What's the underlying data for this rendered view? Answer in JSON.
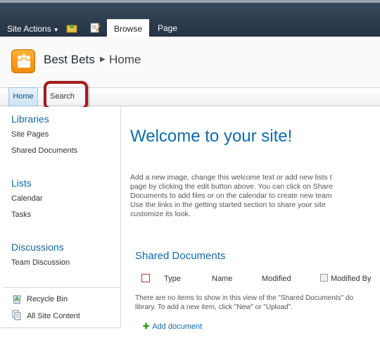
{
  "ribbon": {
    "site_actions": "Site Actions",
    "tabs": [
      {
        "label": "Browse",
        "active": true
      },
      {
        "label": "Page",
        "active": false
      }
    ]
  },
  "header": {
    "site_title": "Best Bets",
    "page_name": "Home"
  },
  "topnav": {
    "items": [
      {
        "label": "Home",
        "selected": true
      },
      {
        "label": "Search",
        "selected": false
      }
    ]
  },
  "quicklaunch": {
    "libraries": {
      "heading": "Libraries",
      "items": [
        "Site Pages",
        "Shared Documents"
      ]
    },
    "lists": {
      "heading": "Lists",
      "items": [
        "Calendar",
        "Tasks"
      ]
    },
    "discussions": {
      "heading": "Discussions",
      "items": [
        "Team Discussion"
      ]
    },
    "footer": {
      "recycle_bin": "Recycle Bin",
      "all_site_content": "All Site Content"
    }
  },
  "main": {
    "welcome_title": "Welcome to your site!",
    "intro_lines": [
      "Add a new image, change this welcome text or add new lists t",
      "page by clicking the edit button above. You can click on Share",
      "Documents to add files or on the calendar to create new team",
      "Use the links in the getting started section to share your site",
      "customize its look."
    ],
    "shared_documents": {
      "title": "Shared Documents",
      "columns": [
        "Type",
        "Name",
        "Modified",
        "Modified By"
      ],
      "empty_message_lines": [
        "There are no items to show in this view of the \"Shared Documents\" do",
        "library. To add a new item, click \"New\" or \"Upload\"."
      ],
      "add_document": "Add document"
    }
  },
  "colors": {
    "ribbon": "#2c3a4d",
    "link_blue": "#0f6aa8",
    "highlight_ring": "#a31b1b",
    "logo_orange": "#f5a021"
  }
}
